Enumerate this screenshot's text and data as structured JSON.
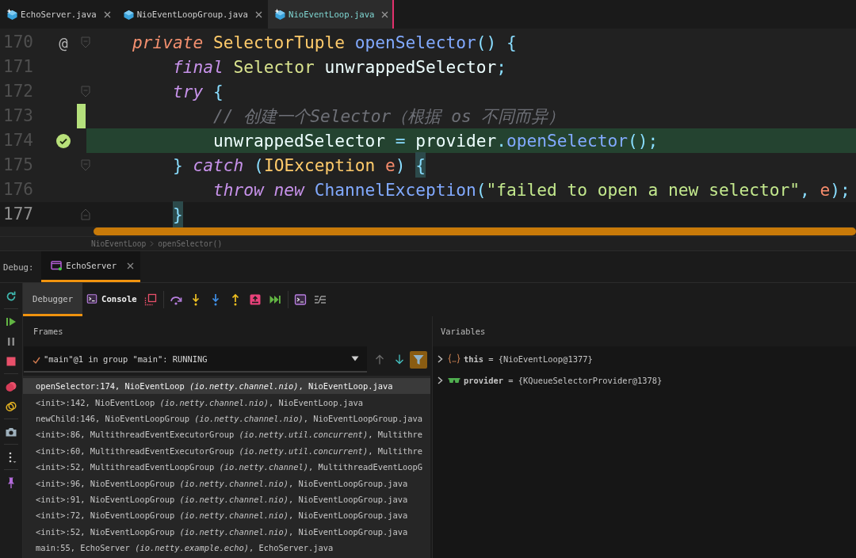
{
  "editor_tabs": [
    {
      "label": "EchoServer.java",
      "starred": true,
      "selected": false
    },
    {
      "label": "NioEventLoopGroup.java",
      "starred": false,
      "selected": false
    },
    {
      "label": "NioEventLoop.java",
      "starred": true,
      "selected": true
    }
  ],
  "editor": {
    "lines": [
      {
        "number": "170",
        "gutter_text": "@",
        "execution_point": false,
        "changed": false,
        "fold_start": true,
        "fold_end": false,
        "highlighted": false,
        "current": false,
        "tokens": [
          {
            "text": "private ",
            "kind": "modifier"
          },
          {
            "text": "SelectorTuple ",
            "kind": "class"
          },
          {
            "text": "openSelector",
            "kind": "method"
          },
          {
            "text": "() {",
            "kind": "punct"
          }
        ],
        "children": [
          {
            "number": "171",
            "execution_point": false,
            "changed": false,
            "fold_start": false,
            "fold_end": false,
            "highlighted": false,
            "current": false,
            "tokens": [
              {
                "text": "final ",
                "kind": "keyword"
              },
              {
                "text": "Selector ",
                "kind": "type"
              },
              {
                "text": "unwrappedSelector",
                "kind": "plain"
              },
              {
                "text": ";",
                "kind": "punct"
              }
            ]
          },
          {
            "number": "172",
            "execution_point": false,
            "changed": false,
            "fold_start": true,
            "fold_end": false,
            "highlighted": false,
            "current": false,
            "tokens": [
              {
                "text": "try ",
                "kind": "keyword"
              },
              {
                "text": "{",
                "kind": "punct"
              }
            ],
            "children": [
              {
                "number": "173",
                "execution_point": false,
                "changed": true,
                "fold_start": false,
                "fold_end": false,
                "highlighted": false,
                "current": false,
                "tokens": [
                  {
                    "text": "// 创建一个Selector（根据 os 不同而异）",
                    "kind": "comment"
                  }
                ]
              },
              {
                "number": "174",
                "execution_point": true,
                "changed": false,
                "fold_start": false,
                "fold_end": false,
                "highlighted": true,
                "current": false,
                "tokens": [
                  {
                    "text": "unwrappedSelector ",
                    "kind": "plain"
                  },
                  {
                    "text": "= ",
                    "kind": "punct"
                  },
                  {
                    "text": "provider",
                    "kind": "plain"
                  },
                  {
                    "text": ".",
                    "kind": "punct"
                  },
                  {
                    "text": "openSelector",
                    "kind": "method"
                  },
                  {
                    "text": "();",
                    "kind": "punct"
                  }
                ]
              }
            ]
          },
          {
            "number": "175",
            "execution_point": false,
            "changed": false,
            "fold_start": true,
            "fold_end": false,
            "highlighted": false,
            "current": false,
            "tokens": [
              {
                "text": "} ",
                "kind": "punct"
              },
              {
                "text": "catch ",
                "kind": "keyword"
              },
              {
                "text": "(",
                "kind": "punct"
              },
              {
                "text": "IOException ",
                "kind": "class"
              },
              {
                "text": "e",
                "kind": "param"
              },
              {
                "text": ") ",
                "kind": "punct"
              },
              {
                "text": "{",
                "kind": "brace_match"
              }
            ],
            "children": [
              {
                "number": "176",
                "execution_point": false,
                "changed": false,
                "fold_start": false,
                "fold_end": false,
                "highlighted": false,
                "current": false,
                "tokens": [
                  {
                    "text": "throw new ",
                    "kind": "keyword"
                  },
                  {
                    "text": "ChannelException",
                    "kind": "method"
                  },
                  {
                    "text": "(",
                    "kind": "punct"
                  },
                  {
                    "text": "\"failed to open a new selector\"",
                    "kind": "string"
                  },
                  {
                    "text": ", ",
                    "kind": "punct"
                  },
                  {
                    "text": "e",
                    "kind": "param"
                  },
                  {
                    "text": ");",
                    "kind": "punct"
                  }
                ]
              }
            ]
          },
          {
            "number": "177",
            "execution_point": false,
            "changed": false,
            "fold_start": false,
            "fold_end": true,
            "highlighted": false,
            "current": true,
            "tokens": [
              {
                "text": "}",
                "kind": "brace_match"
              }
            ]
          }
        ]
      }
    ]
  },
  "breadcrumb": [
    "NioEventLoop",
    "openSelector()"
  ],
  "debug": {
    "label": "Debug:",
    "sessions": [
      {
        "label": "EchoServer",
        "selected": true
      }
    ],
    "tabs": [
      {
        "label": "Debugger",
        "kind": "debugger",
        "selected": true
      },
      {
        "label": "Console",
        "kind": "console",
        "selected": false
      }
    ],
    "frames": {
      "title": "Frames",
      "thread": "\"main\"@1 in group \"main\": RUNNING",
      "filter_on": true,
      "rows": [
        {
          "text": "openSelector:174, NioEventLoop *(io.netty.channel.nio)*, NioEventLoop.java",
          "selected": true
        },
        {
          "text": "<init>:142, NioEventLoop *(io.netty.channel.nio)*, NioEventLoop.java",
          "selected": false
        },
        {
          "text": "newChild:146, NioEventLoopGroup *(io.netty.channel.nio)*, NioEventLoopGroup.java",
          "selected": false
        },
        {
          "text": "<init>:86, MultithreadEventExecutorGroup *(io.netty.util.concurrent)*, Multithre",
          "selected": false
        },
        {
          "text": "<init>:60, MultithreadEventExecutorGroup *(io.netty.util.concurrent)*, Multithre",
          "selected": false
        },
        {
          "text": "<init>:52, MultithreadEventLoopGroup *(io.netty.channel)*, MultithreadEventLoopG",
          "selected": false
        },
        {
          "text": "<init>:96, NioEventLoopGroup *(io.netty.channel.nio)*, NioEventLoopGroup.java",
          "selected": false
        },
        {
          "text": "<init>:91, NioEventLoopGroup *(io.netty.channel.nio)*, NioEventLoopGroup.java",
          "selected": false
        },
        {
          "text": "<init>:72, NioEventLoopGroup *(io.netty.channel.nio)*, NioEventLoopGroup.java",
          "selected": false
        },
        {
          "text": "<init>:52, NioEventLoopGroup *(io.netty.channel.nio)*, NioEventLoopGroup.java",
          "selected": false
        },
        {
          "text": "main:55, EchoServer *(io.netty.example.echo)*, EchoServer.java",
          "selected": false
        }
      ]
    },
    "variables": {
      "title": "Variables",
      "items": [
        {
          "kind": "object",
          "text": "**this** = {NioEventLoop@1377}",
          "expanded": false
        },
        {
          "kind": "field",
          "text": "**provider** = {KQueueSelectorProvider@1378}",
          "expanded": false
        }
      ]
    }
  }
}
